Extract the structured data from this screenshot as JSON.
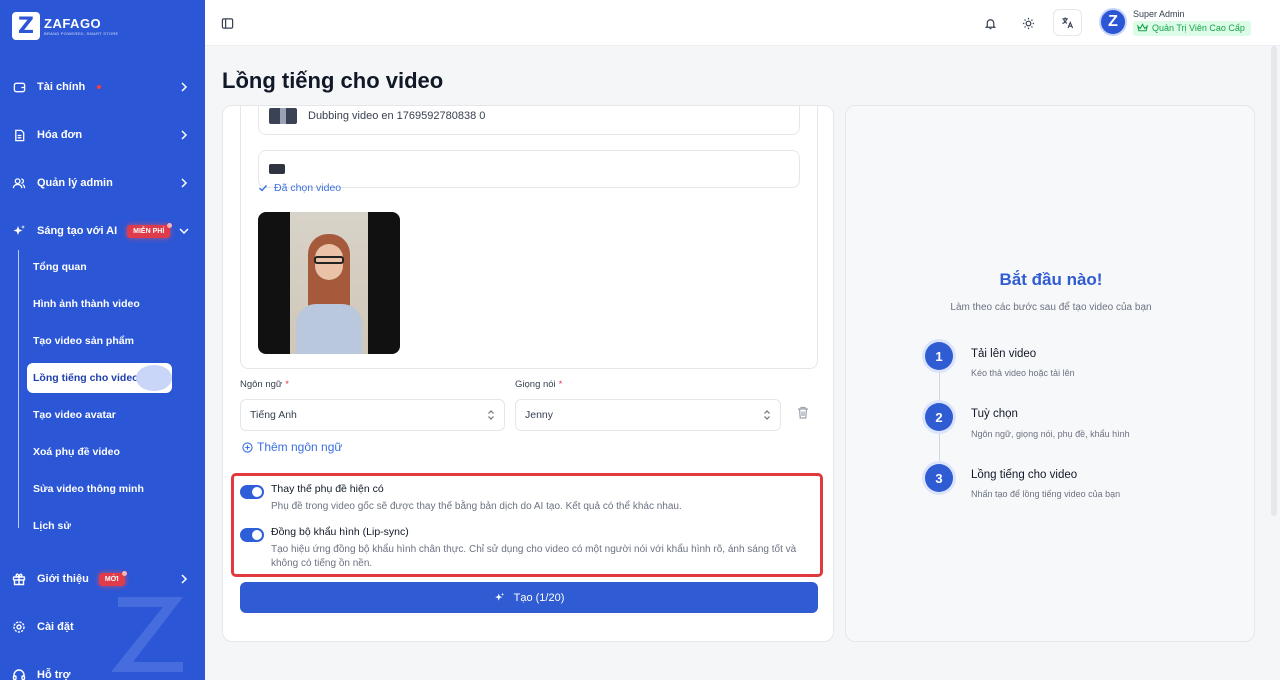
{
  "brand": {
    "name": "ZAFAGO",
    "tagline": "BRAND POWERED, SMART STORE"
  },
  "sidebar": {
    "items": [
      {
        "label": "Tài chính"
      },
      {
        "label": "Hóa đơn"
      },
      {
        "label": "Quản lý admin"
      },
      {
        "label": "Sáng tạo với AI",
        "badge": "MIỄN PHÍ"
      },
      {
        "label": "Giới thiệu",
        "badge": "MỚI"
      },
      {
        "label": "Cài đặt"
      },
      {
        "label": "Hỗ trợ"
      }
    ],
    "sub_items": [
      {
        "label": "Tổng quan"
      },
      {
        "label": "Hình ảnh thành video"
      },
      {
        "label": "Tạo video sản phẩm"
      },
      {
        "label": "Lồng tiếng cho video",
        "active": true
      },
      {
        "label": "Tạo video avatar"
      },
      {
        "label": "Xoá phụ đề video"
      },
      {
        "label": "Sửa video thông minh"
      },
      {
        "label": "Lịch sử"
      }
    ]
  },
  "topbar": {
    "icons": [
      "sidebar-toggle-icon",
      "bell-icon",
      "sun-icon",
      "translate-icon"
    ],
    "user": {
      "avatar_letter": "Z",
      "name": "Super Admin",
      "role": "Quản Trị Viên Cao Cấp"
    }
  },
  "page": {
    "title": "Lồng tiếng cho video"
  },
  "form": {
    "videos": [
      {
        "name": "Dubbing video en 1769592780838 0"
      },
      {
        "name": ""
      }
    ],
    "chosen_label": "Đã chọn video",
    "language": {
      "label": "Ngôn ngữ",
      "value": "Tiếng Anh"
    },
    "voice": {
      "label": "Giọng nói",
      "value": "Jenny"
    },
    "required_mark": "*",
    "add_language": "Thêm ngôn ngữ",
    "options": [
      {
        "title": "Thay thế phụ đề hiện có",
        "desc": "Phụ đề trong video gốc sẽ được thay thế bằng bản dịch do AI tạo. Kết quả có thể khác nhau.",
        "enabled": true
      },
      {
        "title": "Đồng bộ khẩu hình (Lip-sync)",
        "desc_line1": "Tạo hiệu ứng đồng bộ khẩu hình chân thực. Chỉ sử dụng cho video có một người nói với khẩu hình rõ, ánh sáng tốt và",
        "desc_line2": "không có tiếng ồn nền.",
        "enabled": true
      }
    ],
    "create_button": "Tạo (1/20)"
  },
  "guide": {
    "title": "Bắt đầu nào!",
    "subtitle": "Làm theo các bước sau để tạo video của bạn",
    "steps": [
      {
        "num": "1",
        "title": "Tải lên video",
        "desc": "Kéo thả video hoặc tải lên"
      },
      {
        "num": "2",
        "title": "Tuỳ chọn",
        "desc": "Ngôn ngữ, giọng nói, phụ đề, khẩu hình"
      },
      {
        "num": "3",
        "title": "Lồng tiếng cho video",
        "desc": "Nhấn tạo để lồng tiếng video của bạn"
      }
    ]
  },
  "colors": {
    "sidebar_bg": "#2b56d6",
    "accent": "#2f5bd3",
    "highlight_border": "#e0393e",
    "role_badge_bg": "#dcfce7",
    "role_badge_text": "#16a34a"
  }
}
